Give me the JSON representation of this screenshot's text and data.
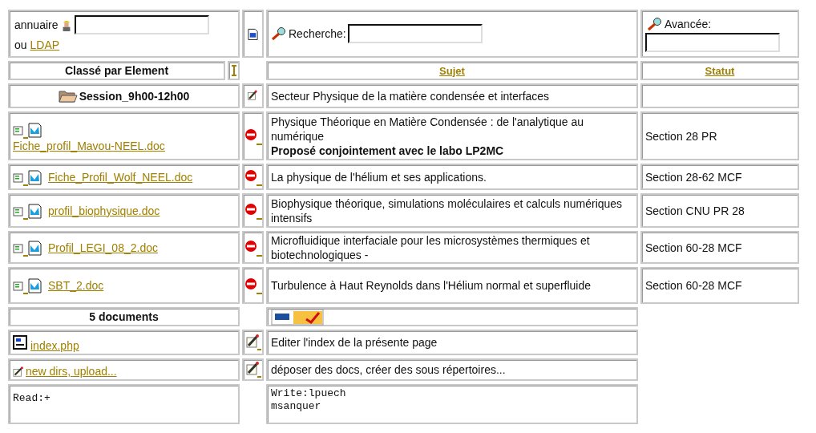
{
  "search": {
    "annuaire_label": "annuaire",
    "ldap_prefix": "ou",
    "ldap_link": "LDAP",
    "recherche_label": "Recherche:",
    "avancee_label": "Avancée:"
  },
  "header": {
    "element": "Classé par Element",
    "sujet": "Sujet",
    "statut": "Statut"
  },
  "session": {
    "folder": "Session_9h00-12h00",
    "sujet": "Secteur Physique de la matière condensée et interfaces"
  },
  "rows": [
    {
      "file": "Fiche_profil_Mavou-NEEL.doc",
      "sujet": "Physique Théorique en Matière Condensée : de l'analytique au numérique",
      "note": "Proposé conjointement avec le labo LP2MC",
      "statut": "Section 28 PR"
    },
    {
      "file": "Fiche_Profil_Wolf_NEEL.doc",
      "sujet": "La physique de l'hélium et ses applications.",
      "statut": "Section 28-62 MCF"
    },
    {
      "file": "profil_biophysique.doc",
      "sujet": "Biophysique théorique, simulations moléculaires et calculs numériques intensifs",
      "statut": "Section CNU PR 28"
    },
    {
      "file": "Profil_LEGI_08_2.doc",
      "sujet": "Microfluidique interfaciale pour les microsystèmes thermiques et biotechnologiques -",
      "statut": "Section 60-28 MCF"
    },
    {
      "file": "SBT_2.doc",
      "sujet": "Turbulence à Haut Reynolds dans l'Hélium normal et superfluide",
      "statut": "Section 60-28 MCF"
    }
  ],
  "count": "5 documents",
  "actions": [
    {
      "kind": "index",
      "link": "index.php",
      "text": "Editer l'index de la présente page"
    },
    {
      "kind": "upload",
      "link": "new dirs, upload...",
      "text": "déposer des docs, créer des sous répertoires..."
    }
  ],
  "permissions": {
    "read": "Read:+",
    "write": [
      "Write:lpuech",
      "msanquer"
    ]
  }
}
